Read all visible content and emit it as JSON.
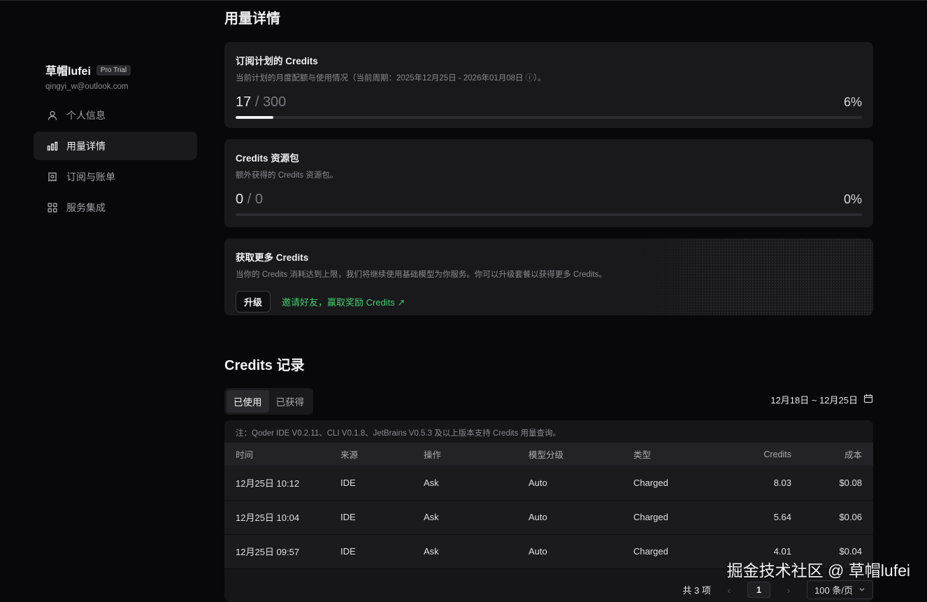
{
  "sidebar": {
    "username": "草帽lufei",
    "plan_badge": "Pro Trial",
    "email": "qingyi_w@outlook.com",
    "items": [
      {
        "label": "个人信息",
        "icon": "user-icon"
      },
      {
        "label": "用量详情",
        "icon": "bar-chart-icon",
        "active": true
      },
      {
        "label": "订阅与账单",
        "icon": "bill-icon"
      },
      {
        "label": "服务集成",
        "icon": "grid-icon"
      }
    ]
  },
  "main": {
    "page_title": "用量详情",
    "subscription": {
      "title": "订阅计划的 Credits",
      "subtitle": "当前计划的月度配额与使用情况（当前周期：2025年12月25日 - 2026年01月08日 ⓘ）。",
      "used": "17",
      "separator": "/",
      "total": "300",
      "percent_text": "6%",
      "percent": 6
    },
    "packs": {
      "title": "Credits 资源包",
      "subtitle": "额外获得的 Credits 资源包。",
      "used": "0",
      "separator": "/",
      "total": "0",
      "percent_text": "0%",
      "percent": 0
    },
    "more": {
      "title": "获取更多 Credits",
      "subtitle": "当你的 Credits 消耗达到上限，我们将继续使用基础模型为你服务。你可以升级套餐以获得更多 Credits。",
      "upgrade_label": "升级",
      "invite_label": "邀请好友，赢取奖励 Credits ↗"
    },
    "records": {
      "title": "Credits 记录",
      "tabs": [
        "已使用",
        "已获得"
      ],
      "date_range": "12月18日 ~ 12月25日",
      "note": "注：Qoder IDE V0.2.11、CLI V0.1.8、JetBrains V0.5.3 及以上版本支持 Credits 用量查询。",
      "columns": [
        "时间",
        "来源",
        "操作",
        "模型分级",
        "类型",
        "Credits",
        "成本"
      ],
      "rows": [
        [
          "12月25日 10:12",
          "IDE",
          "Ask",
          "Auto",
          "Charged",
          "8.03",
          "$0.08"
        ],
        [
          "12月25日 10:04",
          "IDE",
          "Ask",
          "Auto",
          "Charged",
          "5.64",
          "$0.06"
        ],
        [
          "12月25日 09:57",
          "IDE",
          "Ask",
          "Auto",
          "Charged",
          "4.01",
          "$0.04"
        ]
      ],
      "pager": {
        "total_text": "共 3 项",
        "prev": "‹",
        "page": "1",
        "next": "›",
        "page_size": "100 条/页"
      }
    }
  },
  "watermark": "掘金技术社区 @ 草帽lufei"
}
